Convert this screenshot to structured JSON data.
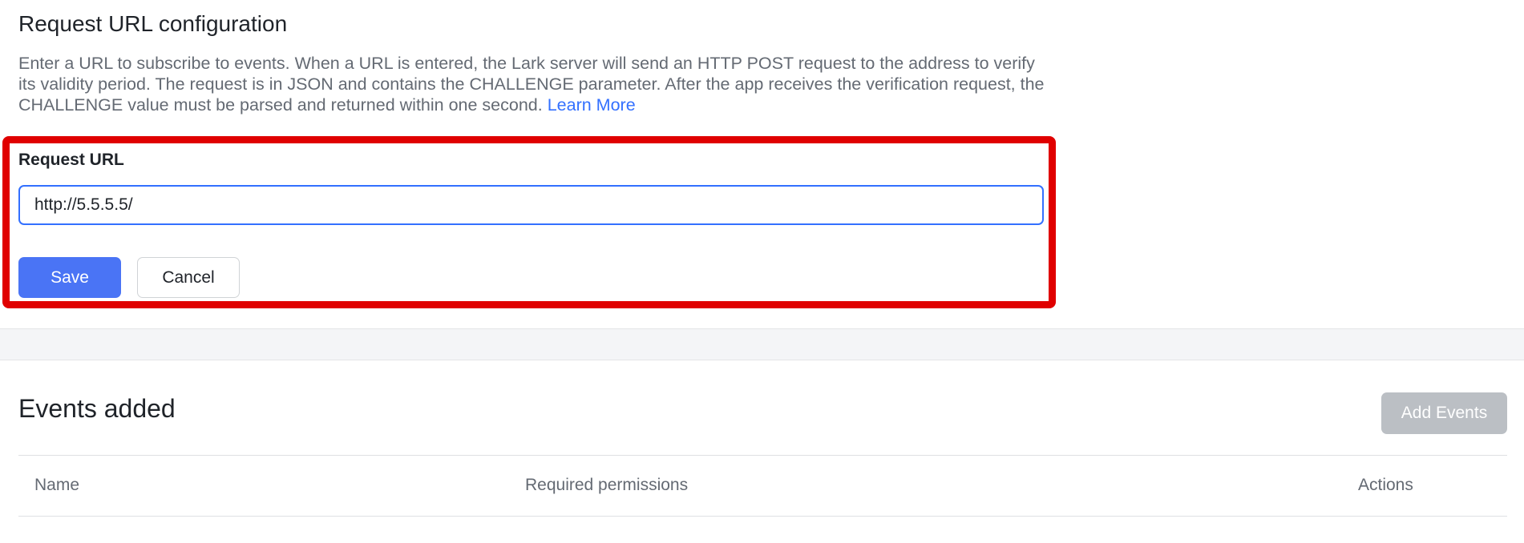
{
  "config": {
    "title": "Request URL configuration",
    "description": "Enter a URL to subscribe to events. When a URL is entered, the Lark server will send an HTTP POST request to the address to verify its validity period. The request is in JSON and contains the CHALLENGE parameter. After the app receives the verification request, the CHALLENGE value must be parsed and returned within one second.",
    "learn_more": "Learn More",
    "field_label": "Request URL",
    "url_value": "http://5.5.5.5/",
    "save_label": "Save",
    "cancel_label": "Cancel",
    "accent_color": "#3370ff",
    "highlight_color": "#e00000"
  },
  "events": {
    "title": "Events added",
    "add_button_label": "Add Events",
    "columns": [
      "Name",
      "Required permissions",
      "Actions"
    ]
  }
}
